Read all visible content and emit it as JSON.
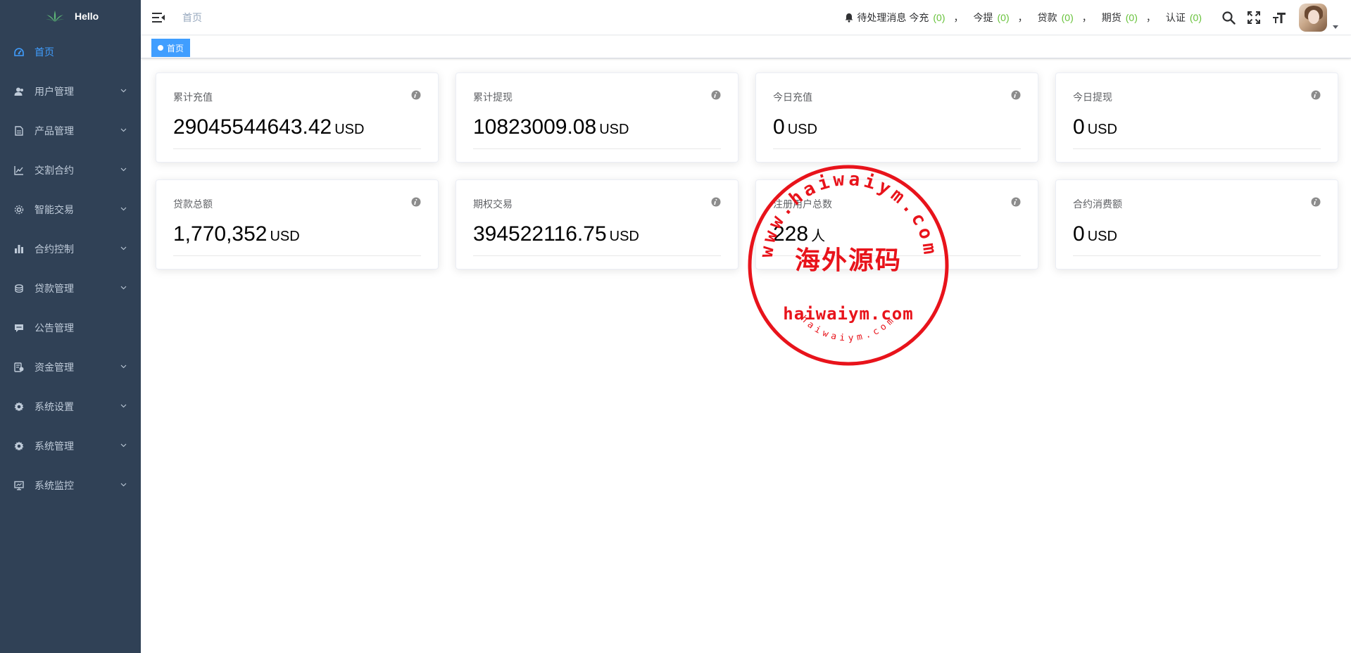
{
  "app": {
    "title": "Hello"
  },
  "sidebar": {
    "items": [
      {
        "label": "首页",
        "icon": "dashboard-icon",
        "active": true,
        "has_children": false
      },
      {
        "label": "用户管理",
        "icon": "user-icon",
        "active": false,
        "has_children": true
      },
      {
        "label": "产品管理",
        "icon": "document-icon",
        "active": false,
        "has_children": true
      },
      {
        "label": "交割合约",
        "icon": "chart-line-icon",
        "active": false,
        "has_children": true
      },
      {
        "label": "智能交易",
        "icon": "cog-icon",
        "active": false,
        "has_children": true
      },
      {
        "label": "合约控制",
        "icon": "bar-chart-icon",
        "active": false,
        "has_children": true
      },
      {
        "label": "贷款管理",
        "icon": "coins-icon",
        "active": false,
        "has_children": true
      },
      {
        "label": "公告管理",
        "icon": "message-icon",
        "active": false,
        "has_children": false
      },
      {
        "label": "资金管理",
        "icon": "money-icon",
        "active": false,
        "has_children": true
      },
      {
        "label": "系统设置",
        "icon": "gear-icon",
        "active": false,
        "has_children": true
      },
      {
        "label": "系统管理",
        "icon": "gear-icon",
        "active": false,
        "has_children": true
      },
      {
        "label": "系统监控",
        "icon": "monitor-icon",
        "active": false,
        "has_children": true
      }
    ]
  },
  "navbar": {
    "breadcrumb": "首页",
    "notice": {
      "label": "待处理消息",
      "items": [
        {
          "label": "今充",
          "count": "(0)"
        },
        {
          "label": "今提",
          "count": "(0)"
        },
        {
          "label": "贷款",
          "count": "(0)"
        },
        {
          "label": "期货",
          "count": "(0)"
        },
        {
          "label": "认证",
          "count": "(0)"
        }
      ],
      "separator": "，"
    }
  },
  "tags": {
    "active": "首页"
  },
  "cards": [
    {
      "title": "累计充值",
      "value": "29045544643.42",
      "unit": "USD"
    },
    {
      "title": "累计提现",
      "value": "10823009.08",
      "unit": "USD"
    },
    {
      "title": "今日充值",
      "value": "0",
      "unit": "USD"
    },
    {
      "title": "今日提现",
      "value": "0",
      "unit": "USD"
    },
    {
      "title": "贷款总额",
      "value": "1,770,352",
      "unit": "USD"
    },
    {
      "title": "期权交易",
      "value": "394522116.75",
      "unit": "USD"
    },
    {
      "title": "注册用户总数",
      "value": "228",
      "unit": "人"
    },
    {
      "title": "合约消费额",
      "value": "0",
      "unit": "USD"
    }
  ],
  "stamp": {
    "ring_text": "www.haiwaiym.com",
    "center_text": "海外源码",
    "domain_text": "haiwaiym.com",
    "small_ring_text": "haiwaiym.com",
    "color": "#e8131b"
  },
  "colors": {
    "sidebar_bg": "#304156",
    "sidebar_text": "#bfcbd9",
    "active": "#409eff",
    "count_green": "#67c23a"
  }
}
